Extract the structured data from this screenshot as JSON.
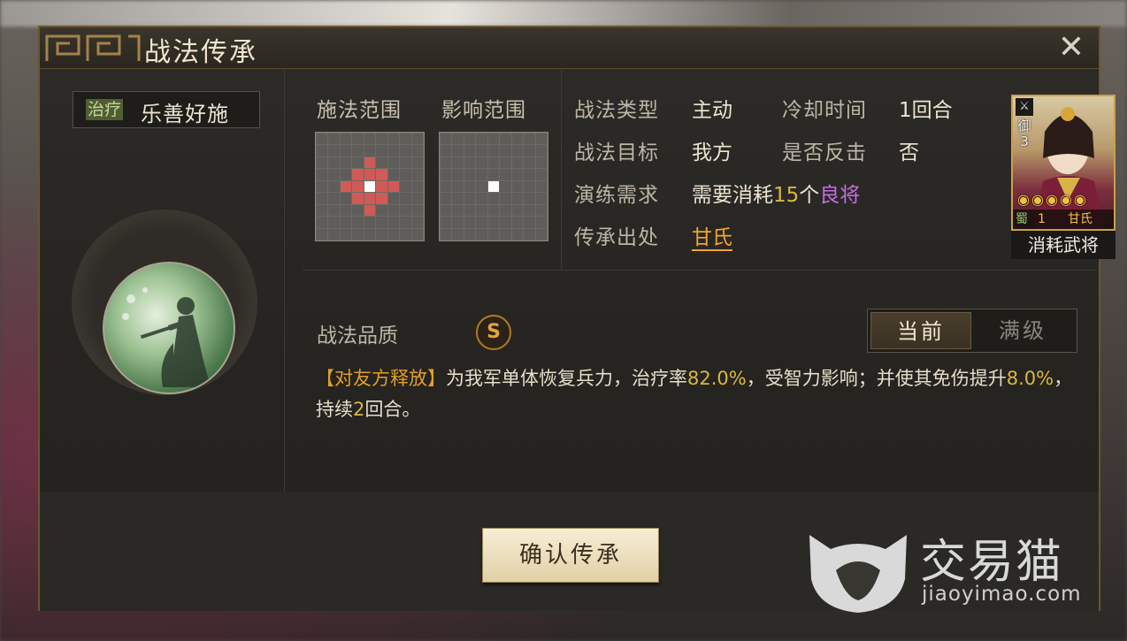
{
  "dialog": {
    "title": "战法传承",
    "close_icon": "close-icon"
  },
  "skill": {
    "tag": "治疗",
    "name": "乐善好施"
  },
  "ranges": {
    "cast_label": "施法范围",
    "effect_label": "影响范围"
  },
  "info": {
    "type_label": "战法类型",
    "type_value": "主动",
    "cooldown_label": "冷却时间",
    "cooldown_value": "1回合",
    "target_label": "战法目标",
    "target_value": "我方",
    "counter_label": "是否反击",
    "counter_value": "否",
    "training_label": "演练需求",
    "training_prefix": "需要消耗",
    "training_count": "15",
    "training_unit": "个",
    "training_item": "良将",
    "source_label": "传承出处",
    "source_value": "甘氏"
  },
  "card": {
    "caption": "消耗武将",
    "unit_type": "御",
    "cost": "3",
    "faction": "蜀",
    "level": "1",
    "name": "甘氏",
    "stars": 5
  },
  "quality": {
    "label": "战法品质",
    "grade": "S"
  },
  "level_toggle": {
    "current": "当前",
    "max": "满级"
  },
  "description": {
    "bracket": "【对友方释放】",
    "p1": "为我军单体恢复兵力，治疗率",
    "v1": "82.0%",
    "p2": "，受智力影响；并使其免伤提升",
    "v2": "8.0%",
    "p3": "，持续",
    "v3": "2",
    "p4": "回合。"
  },
  "footer": {
    "confirm_label": "确认传承"
  },
  "watermark": {
    "brand": "交易猫",
    "url": "jiaoyimao.com"
  },
  "colors": {
    "highlight": "#d9b740",
    "purple": "#c46ee0",
    "orange": "#f0a430",
    "range_red": "#d05a56"
  }
}
